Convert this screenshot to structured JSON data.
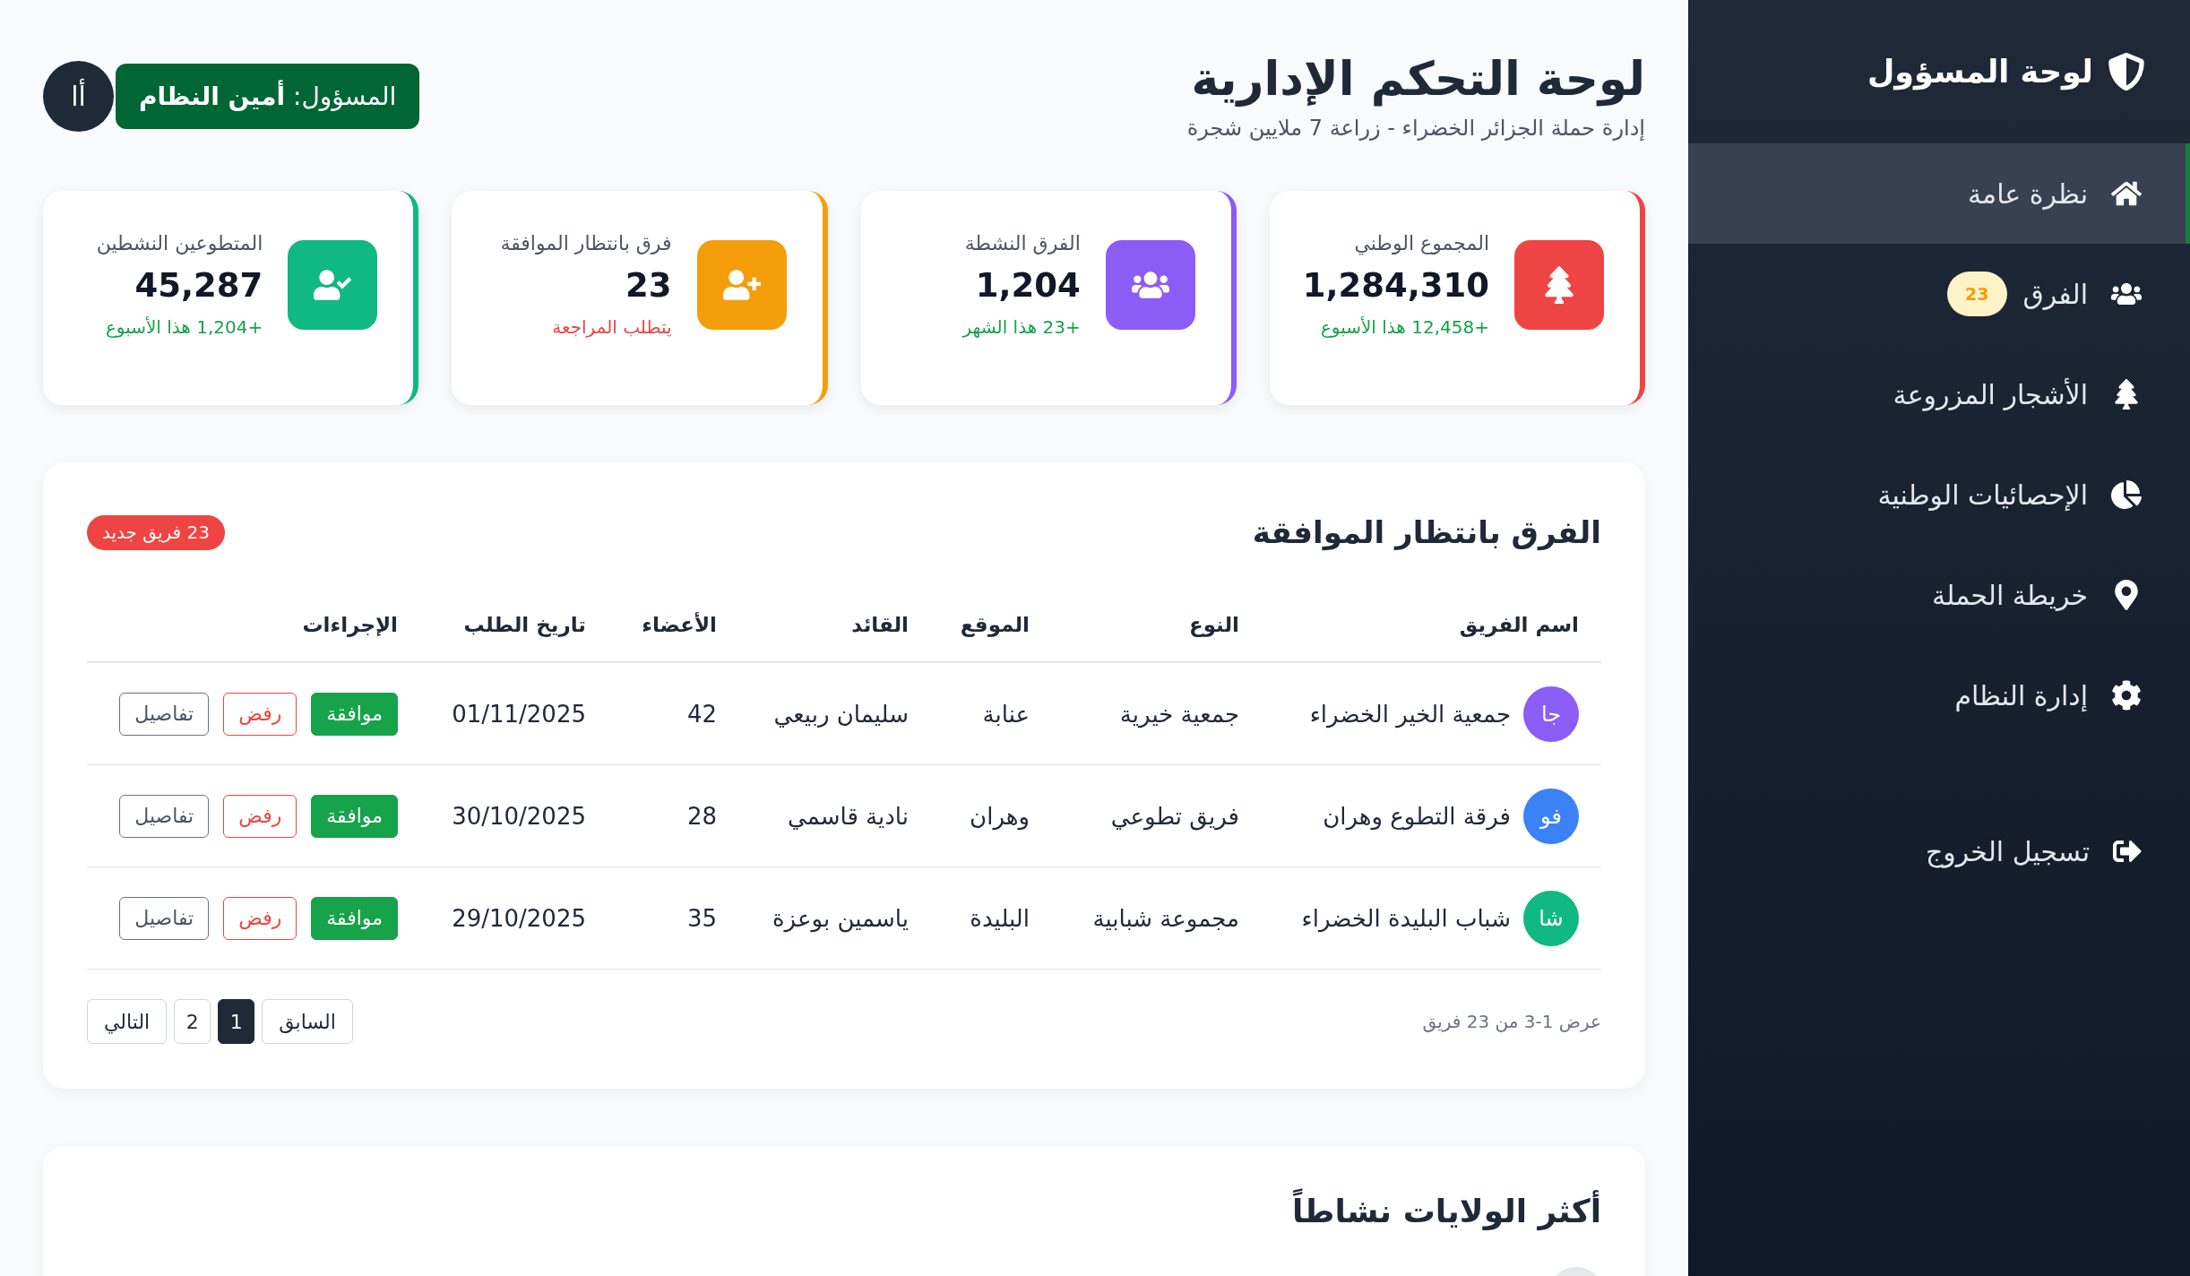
{
  "sidebar": {
    "title": "لوحة المسؤول",
    "items": [
      {
        "label": "نظرة عامة",
        "selected": true
      },
      {
        "label": "الفرق",
        "selected": false,
        "badge": "23"
      },
      {
        "label": "الأشجار المزروعة",
        "selected": false
      },
      {
        "label": "الإحصائيات الوطنية",
        "selected": false
      },
      {
        "label": "خريطة الحملة",
        "selected": false
      },
      {
        "label": "إدارة النظام",
        "selected": false
      }
    ],
    "logout": "تسجيل الخروج"
  },
  "header": {
    "title": "لوحة التحكم الإدارية",
    "subtitle": "إدارة حملة الجزائر الخضراء - زراعة 7 ملايين شجرة",
    "admin": {
      "label": "المسؤول: **أمين النظام**",
      "initials": "أا"
    }
  },
  "stats": [
    {
      "label": "المجموع الوطني",
      "value": "1,284,310",
      "note": "+12,458 هذا الأسبوع",
      "alert": false,
      "color": "#ef4444"
    },
    {
      "label": "الفرق النشطة",
      "value": "1,204",
      "note": "+23 هذا الشهر",
      "alert": false,
      "color": "#8b5cf6"
    },
    {
      "label": "فرق بانتظار الموافقة",
      "value": "23",
      "note": "يتطلب المراجعة",
      "alert": true,
      "color": "#f59e0b"
    },
    {
      "label": "المتطوعين النشطين",
      "value": "45,287",
      "note": "+1,204 هذا الأسبوع",
      "alert": false,
      "color": "#10b981"
    }
  ],
  "pending": {
    "title": "الفرق بانتظار الموافقة",
    "badge": "23 فريق جديد",
    "columns": [
      "اسم الفريق",
      "النوع",
      "الموقع",
      "القائد",
      "الأعضاء",
      "تاريخ الطلب",
      "الإجراءات"
    ],
    "rows": [
      {
        "initials": "جا",
        "color": "#8b5cf6",
        "name": "جمعية الخير الخضراء",
        "type": "جمعية خيرية",
        "location": "عنابة",
        "leader": "سليمان ربيعي",
        "members": "42",
        "date": "01/11/2025",
        "actions": [
          {
            "label": "موافقة",
            "kind": "approve"
          },
          {
            "label": "رفض",
            "kind": "reject"
          },
          {
            "label": "تفاصيل",
            "kind": "details"
          }
        ]
      },
      {
        "initials": "فو",
        "color": "#3b82f6",
        "name": "فرقة التطوع وهران",
        "type": "فريق تطوعي",
        "location": "وهران",
        "leader": "نادية قاسمي",
        "members": "28",
        "date": "30/10/2025",
        "actions": [
          {
            "label": "موافقة",
            "kind": "approve"
          },
          {
            "label": "رفض",
            "kind": "reject"
          },
          {
            "label": "تفاصيل",
            "kind": "details"
          }
        ]
      },
      {
        "initials": "شا",
        "color": "#10b981",
        "name": "شباب البليدة الخضراء",
        "type": "مجموعة شبابية",
        "location": "البليدة",
        "leader": "ياسمين بوعزة",
        "members": "35",
        "date": "29/10/2025",
        "actions": [
          {
            "label": "موافقة",
            "kind": "approve"
          },
          {
            "label": "رفض",
            "kind": "reject"
          },
          {
            "label": "تفاصيل",
            "kind": "details"
          }
        ]
      }
    ],
    "pagination": {
      "summary": "عرض 1-3 من 23 فريق",
      "previous": "السابق",
      "pages": [
        {
          "label": "1",
          "selected": true
        },
        {
          "label": "2",
          "selected": false
        }
      ],
      "next": "التالي"
    }
  },
  "regions": {
    "title": "أكثر الولايات نشاطاً"
  }
}
